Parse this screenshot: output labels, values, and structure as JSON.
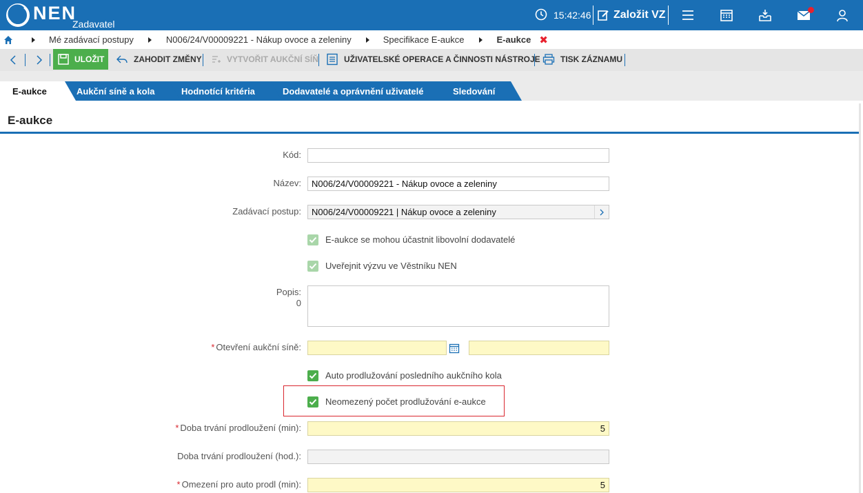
{
  "header": {
    "logo_text": "NEN",
    "logo_sub": "Zadavatel",
    "time": "15:42:46",
    "zalozit_label": "Založit VZ"
  },
  "breadcrumb": {
    "items": [
      "Mé zadávací postupy",
      "N006/24/V00009221 - Nákup ovoce a zeleniny",
      "Specifikace E-aukce",
      "E-aukce"
    ],
    "close": "✖"
  },
  "toolbar": {
    "save": "ULOŽIT",
    "discard": "ZAHODIT ZMĚNY",
    "create_room": "VYTVOŘIT AUKČNÍ SÍŇ",
    "user_ops": "UŽIVATELSKÉ OPERACE A ČINNOSTI NÁSTROJE",
    "print": "TISK ZÁZNAMU"
  },
  "tabs": [
    "E-aukce",
    "Aukční síně a kola",
    "Hodnotící kritéria",
    "Dodavatelé a oprávnění uživatelé",
    "Sledování"
  ],
  "section": {
    "title": "E-aukce"
  },
  "form": {
    "kod_label": "Kód:",
    "kod_value": "",
    "nazev_label": "Název:",
    "nazev_value": "N006/24/V00009221 - Nákup ovoce a zeleniny",
    "postup_label": "Zadávací postup:",
    "postup_value": "N006/24/V00009221 | Nákup ovoce a zeleniny",
    "cb1_label": "E-aukce se mohou účastnit libovolní dodavatelé",
    "cb2_label": "Uveřejnit výzvu ve Věstníku NEN",
    "popis_label": "Popis:",
    "popis_count": "0",
    "popis_value": "",
    "otevreni_label": "Otevření aukční síně:",
    "otevreni_date": "",
    "otevreni_time": "",
    "cb3_label": "Auto prodlužování posledního aukčního kola",
    "cb4_label": "Neomezený počet prodlužování e-aukce",
    "doba_min_label": "Doba trvání prodloužení (min):",
    "doba_min_value": "5",
    "doba_hod_label": "Doba trvání prodloužení (hod.):",
    "doba_hod_value": "",
    "omezeni_label": "Omezení pro auto prodl (min):",
    "omezeni_value": "5"
  },
  "colors": {
    "brand_blue": "#1a6fb5",
    "save_green": "#4cae4c",
    "required_yellow": "#fef9c6",
    "alert_red": "#e8212e"
  }
}
